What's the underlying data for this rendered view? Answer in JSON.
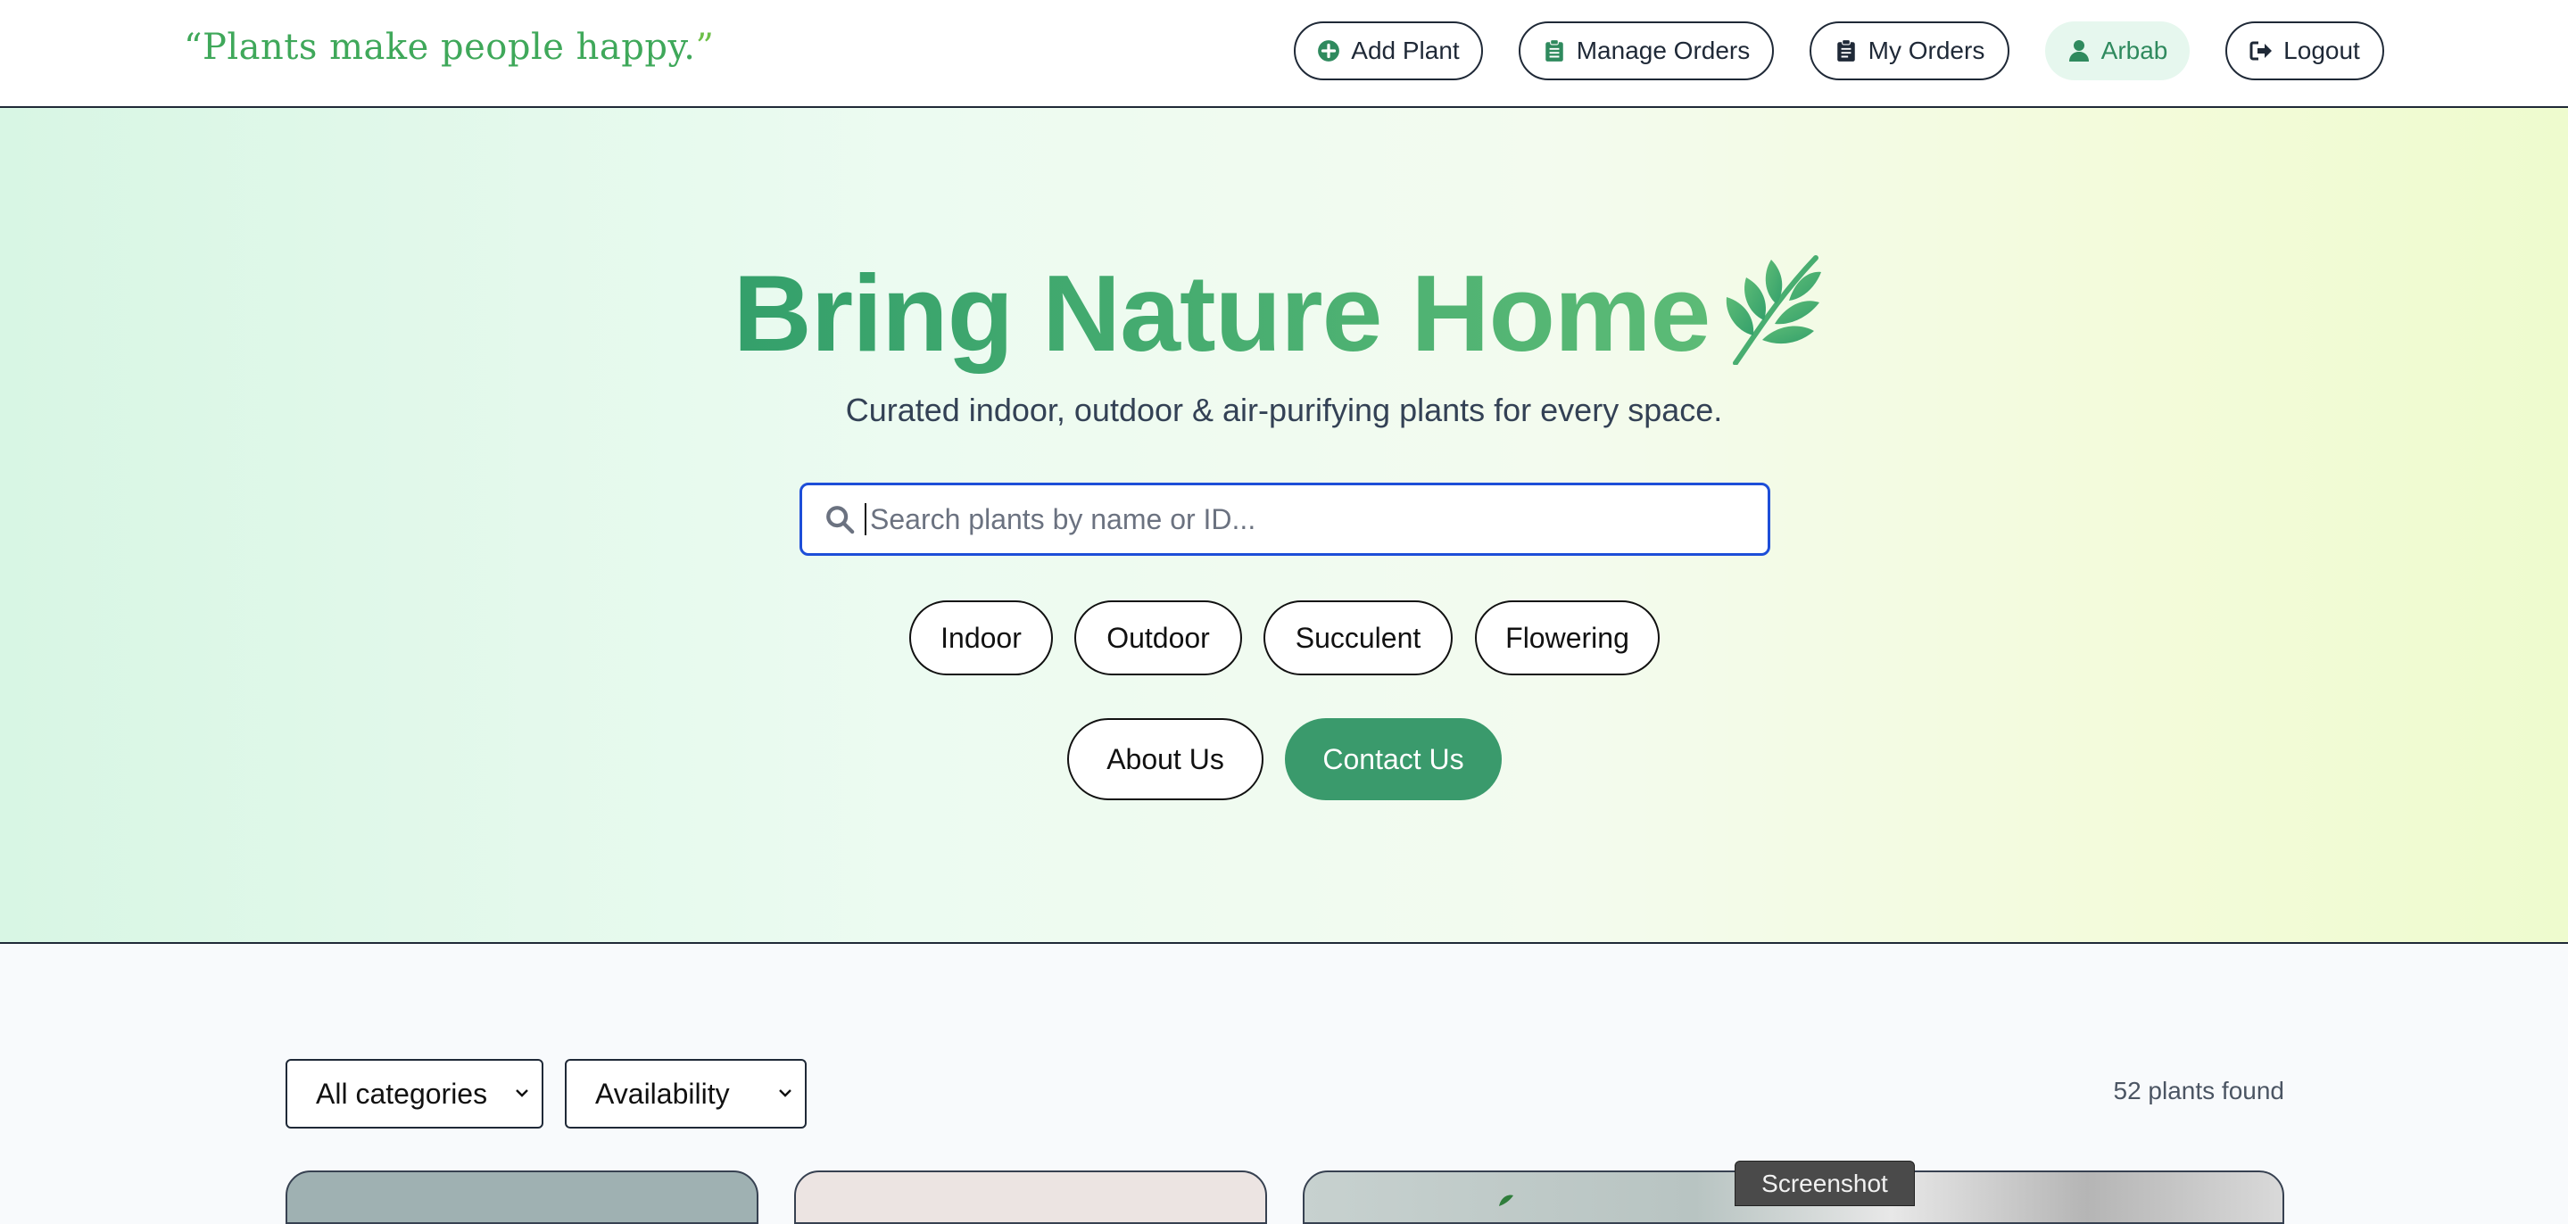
{
  "header": {
    "brand_quote_open": "“",
    "brand_quote_text": "Plants make people happy.",
    "brand_quote_close": "”",
    "nav": {
      "add_plant": "Add Plant",
      "manage_orders": "Manage Orders",
      "my_orders": "My Orders",
      "user": "Arbab",
      "logout": "Logout"
    },
    "icons": {
      "add_plant": "plus-circle-icon",
      "manage_orders": "clipboard-list-icon",
      "my_orders": "clipboard-icon",
      "user": "user-icon",
      "logout": "logout-icon"
    }
  },
  "hero": {
    "title": "Bring Nature Home",
    "title_icon": "leaf-icon",
    "subtitle": "Curated indoor, outdoor & air-purifying plants for every space.",
    "search": {
      "placeholder": "Search plants by name or ID...",
      "value": ""
    },
    "chips": [
      "Indoor",
      "Outdoor",
      "Succulent",
      "Flowering"
    ],
    "about_label": "About Us",
    "contact_label": "Contact Us"
  },
  "filters": {
    "category_selected": "All categories",
    "availability_selected": "Availability",
    "results_count": "52 plants found"
  },
  "overlay": {
    "tooltip": "Screenshot"
  },
  "colors": {
    "brand_green": "#3aa771",
    "accent_button": "#3a9a6c",
    "search_focus": "#1d4ed8",
    "user_pill_bg": "#e6f7ee"
  }
}
